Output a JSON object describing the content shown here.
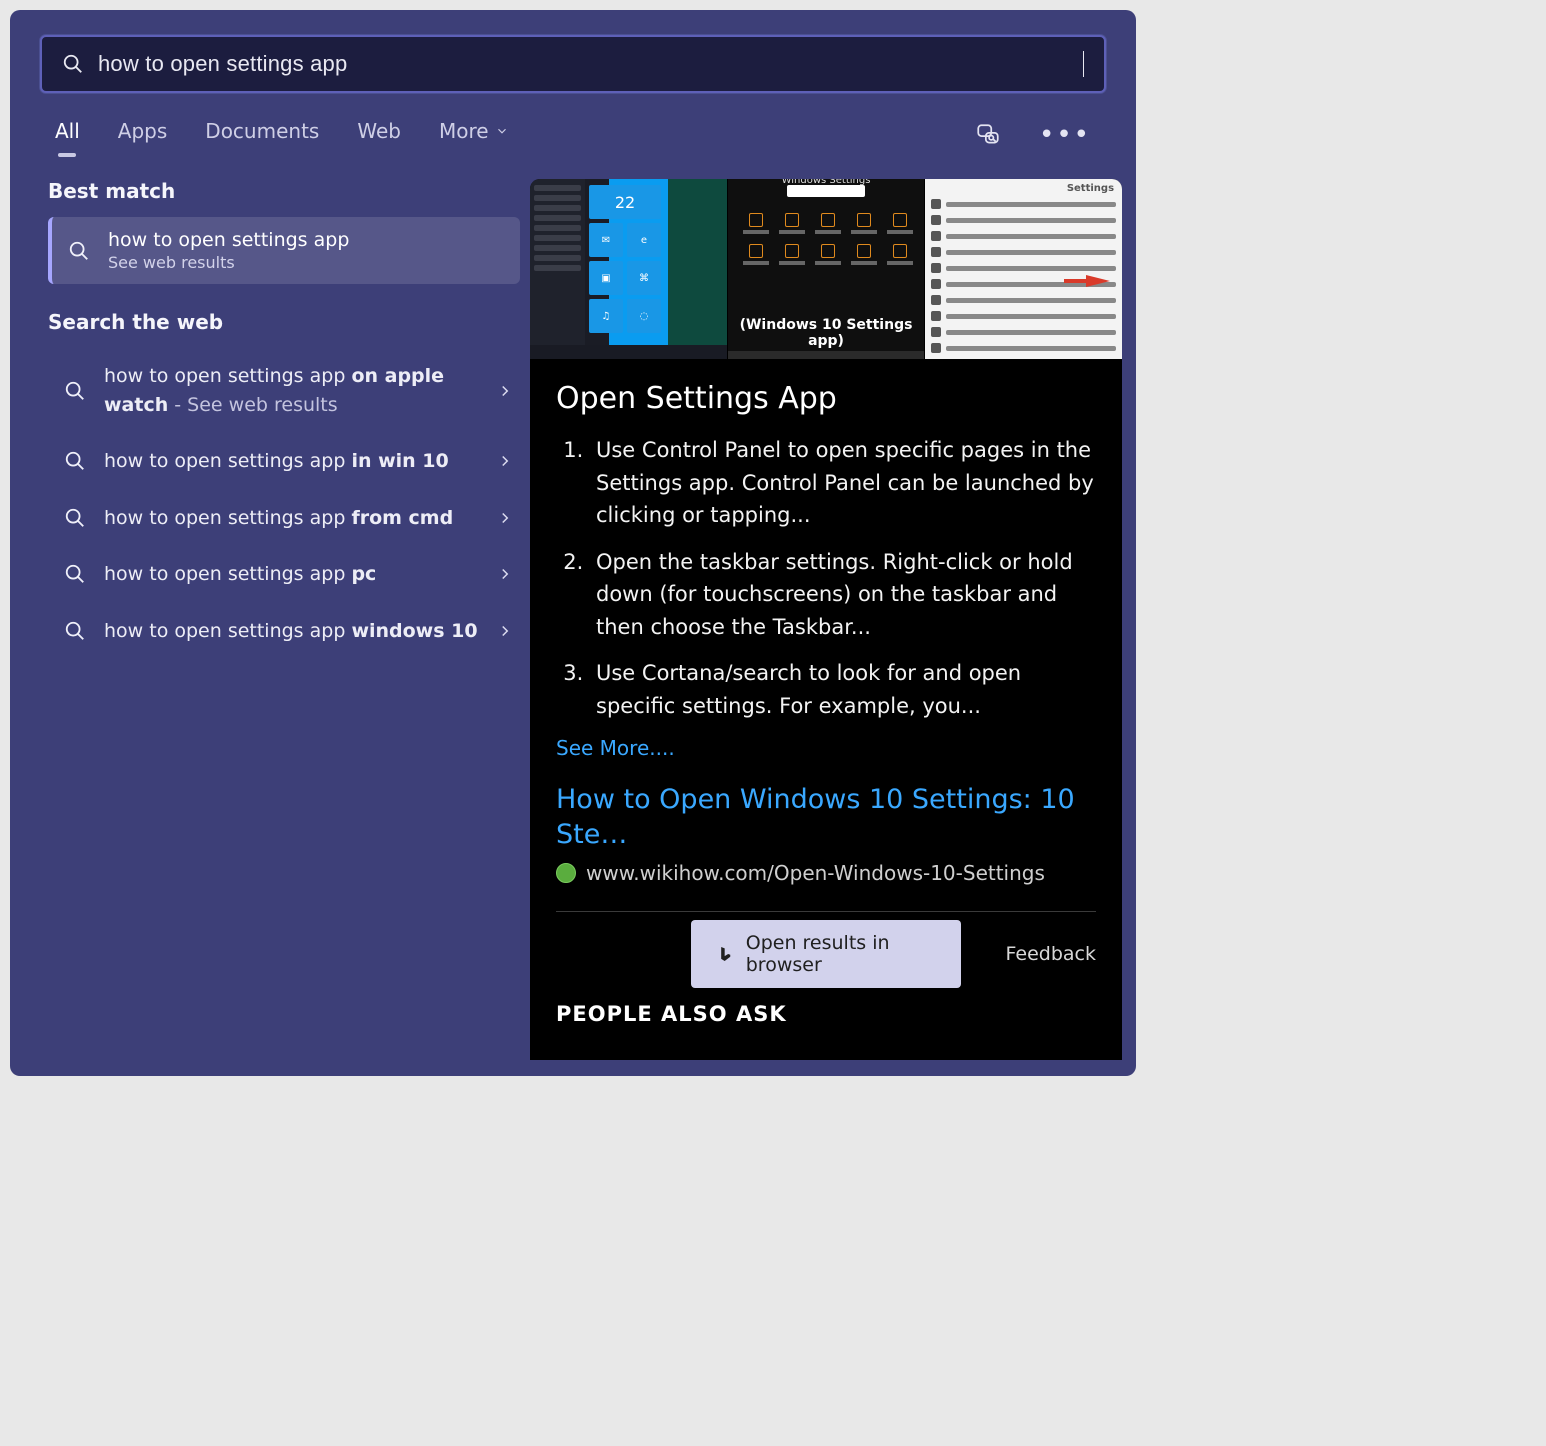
{
  "search": {
    "query": "how to open settings app"
  },
  "filters": {
    "tabs": [
      "All",
      "Apps",
      "Documents",
      "Web",
      "More"
    ],
    "active_index": 0
  },
  "sections": {
    "best_match_header": "Best match",
    "search_web_header": "Search the web"
  },
  "best_match": {
    "title": "how to open settings app",
    "subtitle": "See web results"
  },
  "web_suggestions": [
    {
      "prefix": "how to open settings app ",
      "bold": "on apple watch",
      "suffix_muted": " - See web results"
    },
    {
      "prefix": "how to open settings app ",
      "bold": "in win 10",
      "suffix_muted": ""
    },
    {
      "prefix": "how to open settings app ",
      "bold": "from cmd",
      "suffix_muted": ""
    },
    {
      "prefix": "how to open settings app ",
      "bold": "pc",
      "suffix_muted": ""
    },
    {
      "prefix": "how to open settings app ",
      "bold": "windows 10",
      "suffix_muted": ""
    }
  ],
  "preview": {
    "title": "Open Settings App",
    "steps": [
      "Use Control Panel to open specific pages in the Settings app. Control Panel can be launched by clicking or tapping...",
      "Open the taskbar settings. Right-click or hold down (for touchscreens) on the taskbar and then choose the Taskbar...",
      "Use Cortana/search to look for and open specific settings. For example, you..."
    ],
    "see_more": "See More....",
    "source_title": "How to Open Windows 10 Settings: 10 Ste…",
    "source_url": "www.wikihow.com/Open-Windows-10-Settings",
    "feedback": "Feedback",
    "open_browser": "Open results in browser",
    "people_also_ask": "PEOPLE ALSO ASK",
    "thumb2_caption": "(Windows 10 Settings app)",
    "thumb3_title": "Settings"
  },
  "colors": {
    "window_bg": "#3d3f78",
    "search_bg": "#1c1d3f",
    "accent_link": "#3aa8ff",
    "button_bg": "#d2d2ec"
  }
}
